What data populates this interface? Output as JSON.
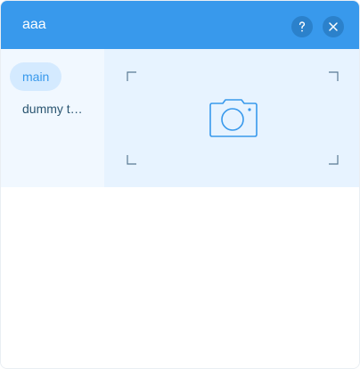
{
  "window": {
    "title": "aaa",
    "help_icon": "question-icon",
    "close_icon": "close-icon"
  },
  "sidebar": {
    "items": [
      {
        "label": "main",
        "active": true
      },
      {
        "label": "dummy t…",
        "active": false
      }
    ]
  },
  "preview": {
    "icon": "camera-icon"
  },
  "colors": {
    "header": "#3899ec",
    "header_button": "#2b81cb",
    "accent": "#3899ec",
    "sidebar_bg": "#f1f8ff",
    "active_item_bg": "#d4eaff",
    "preview_bg": "#e7f3ff",
    "text_dark": "#2b5672"
  }
}
